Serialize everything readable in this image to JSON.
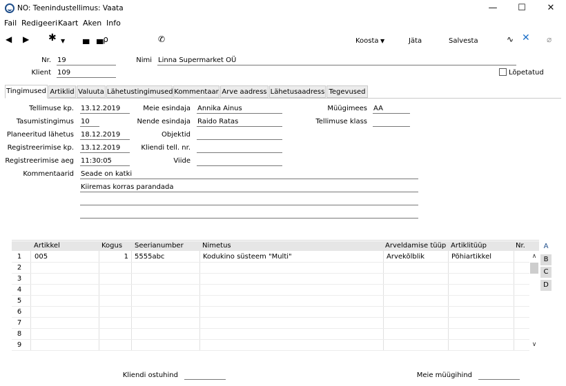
{
  "window": {
    "title": "NO: Teenindustellimus: Vaata",
    "controls": [
      "—",
      "☐",
      "✕"
    ]
  },
  "menu": [
    "Fail",
    "Redigeeri",
    "Kaart",
    "Aken",
    "Info"
  ],
  "toolbar": {
    "create_label": "Koosta",
    "cancel_label": "Jäta",
    "save_label": "Salvesta"
  },
  "header": {
    "nr_label": "Nr.",
    "nr_value": "19",
    "name_label": "Nimi",
    "name_value": "Linna Supermarket OÜ",
    "client_label": "Klient",
    "client_value": "109",
    "finished_label": "Lõpetatud"
  },
  "tabs": [
    "Tingimused",
    "Artiklid",
    "Valuuta",
    "Lähetustingimused",
    "Kommentaar",
    "Arve aadress",
    "Lähetusaadress",
    "Tegevused"
  ],
  "terms": {
    "order_date_label": "Tellimuse kp.",
    "order_date": "13.12.2019",
    "payment_terms_label": "Tasumistingimus",
    "payment_terms": "10",
    "planned_shipment_label": "Planeeritud lähetus",
    "planned_shipment": "18.12.2019",
    "registration_date_label": "Registreerimise kp.",
    "registration_date": "13.12.2019",
    "registration_time_label": "Registreerimise aeg",
    "registration_time": "11:30:05",
    "comments_label": "Kommentaarid",
    "comment_line1": "Seade on katki",
    "comment_line2": "Kiiremas korras parandada",
    "our_contact_label": "Meie esindaja",
    "our_contact": "Annika Ainus",
    "their_contact_label": "Nende esindaja",
    "their_contact": "Raido Ratas",
    "objects_label": "Objektid",
    "client_order_label": "Kliendi tell. nr.",
    "reference_label": "Viide",
    "salesman_label": "Müügimees",
    "salesman": "AA",
    "order_class_label": "Tellimuse klass"
  },
  "grid": {
    "columns": [
      "Artikkel",
      "Kogus",
      "Seerianumber",
      "Nimetus",
      "Arveldamise tüüp",
      "Artiklitüüp",
      "Nr."
    ],
    "row_numbers": [
      "1",
      "2",
      "3",
      "4",
      "5",
      "6",
      "7",
      "8",
      "9"
    ],
    "rows": [
      {
        "artikkel": "005",
        "kogus": "1",
        "seerianumber": "5555abc",
        "nimetus": "Kodukino süsteem \"Multi\"",
        "arveldamise_tyyp": "Arvekõlblik",
        "artiklityyp": "Põhiartikkel",
        "nr": ""
      }
    ],
    "side_tabs": [
      "A",
      "B",
      "C",
      "D"
    ]
  },
  "footer": {
    "purchase_price_label": "Kliendi ostuhind",
    "sales_price_label": "Meie müügihind"
  }
}
